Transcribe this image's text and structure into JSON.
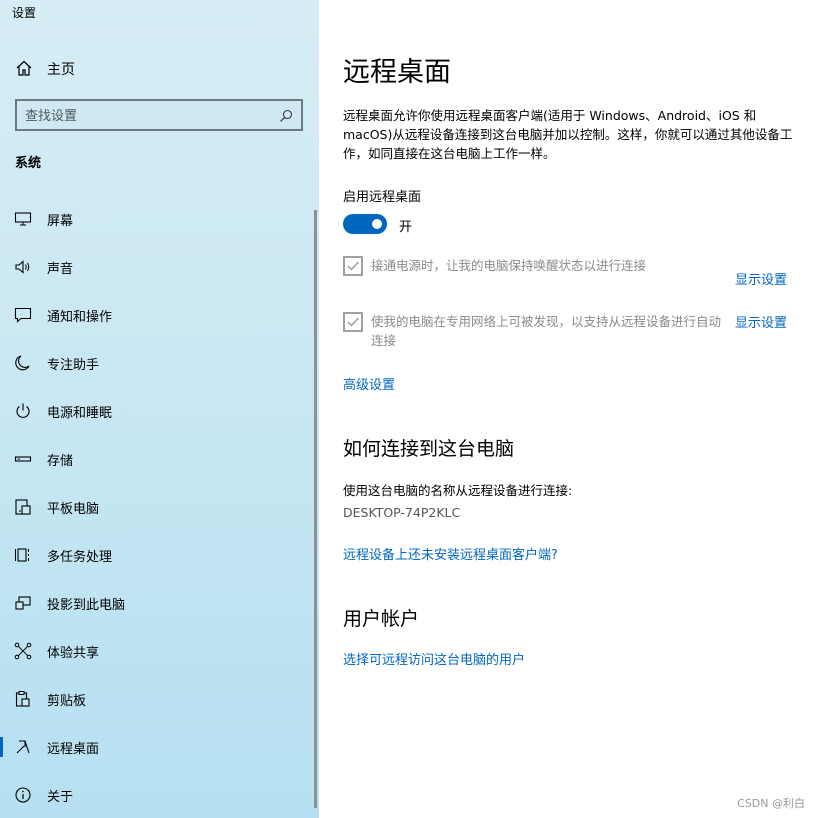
{
  "app": {
    "title": "设置"
  },
  "sidebar": {
    "home_label": "主页",
    "search_placeholder": "查找设置",
    "section_label": "系统",
    "items": [
      {
        "label": "屏幕",
        "icon": "monitor-icon"
      },
      {
        "label": "声音",
        "icon": "speaker-icon"
      },
      {
        "label": "通知和操作",
        "icon": "message-icon"
      },
      {
        "label": "专注助手",
        "icon": "moon-icon"
      },
      {
        "label": "电源和睡眠",
        "icon": "power-icon"
      },
      {
        "label": "存储",
        "icon": "storage-icon"
      },
      {
        "label": "平板电脑",
        "icon": "tablet-icon"
      },
      {
        "label": "多任务处理",
        "icon": "multitask-icon"
      },
      {
        "label": "投影到此电脑",
        "icon": "projection-icon"
      },
      {
        "label": "体验共享",
        "icon": "share-icon"
      },
      {
        "label": "剪贴板",
        "icon": "clipboard-icon"
      },
      {
        "label": "远程桌面",
        "icon": "remote-desktop-icon",
        "selected": true
      },
      {
        "label": "关于",
        "icon": "info-icon"
      }
    ]
  },
  "main": {
    "title": "远程桌面",
    "description": "远程桌面允许你使用远程桌面客户端(适用于 Windows、Android、iOS 和 macOS)从远程设备连接到这台电脑并加以控制。这样，你就可以通过其他设备工作，如同直接在这台电脑上工作一样。",
    "enable_label": "启用远程桌面",
    "toggle_state": "开",
    "checkbox1_label": "接通电源时，让我的电脑保持唤醒状态以进行连接",
    "checkbox2_label": "使我的电脑在专用网络上可被发现，以支持从远程设备进行自动连接",
    "show_settings_1": "显示设置",
    "show_settings_2": "显示设置",
    "advanced_settings": "高级设置",
    "how_to_connect_heading": "如何连接到这台电脑",
    "use_name_text": "使用这台电脑的名称从远程设备进行连接:",
    "pc_name": "DESKTOP-74P2KLC",
    "no_client_link": "远程设备上还未安装远程桌面客户端?",
    "user_accounts_heading": "用户帐户",
    "select_users_link": "选择可远程访问这台电脑的用户"
  },
  "watermark": "CSDN @利白",
  "colors": {
    "accent": "#0067c0",
    "sidebar_bg": "#cbe8f3"
  }
}
